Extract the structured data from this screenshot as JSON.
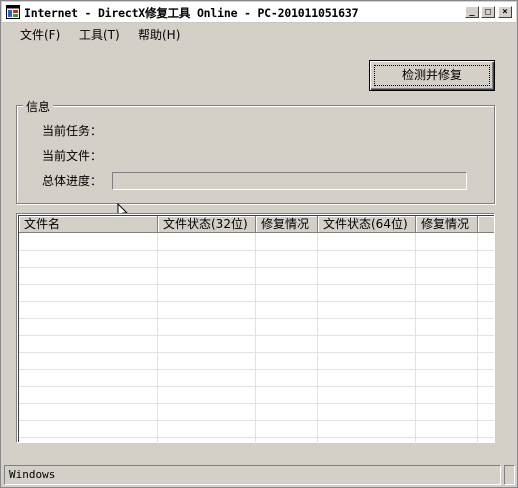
{
  "window": {
    "title": "Internet - DirectX修复工具 Online - PC-201011051637",
    "controls": {
      "minimize": "_",
      "maximize": "□",
      "close": "×"
    }
  },
  "menu": [
    {
      "label": "文件(F)"
    },
    {
      "label": "工具(T)"
    },
    {
      "label": "帮助(H)"
    }
  ],
  "action_button": "检测并修复",
  "info_group": {
    "title": "信息",
    "current_task_label": "当前任务：",
    "current_file_label": "当前文件：",
    "overall_progress_label": "总体进度：",
    "progress": 0
  },
  "table": {
    "columns": [
      "文件名",
      "文件状态(32位)",
      "修复情况",
      "文件状态(64位)",
      "修复情况"
    ],
    "rows": []
  },
  "status_bar": {
    "text": "Windows"
  },
  "colors": {
    "face": "#d4d0c8",
    "shadow": "#808080",
    "highlight": "#ffffff",
    "window": "#ffffff"
  },
  "icons": [
    "app-icon",
    "mouse-cursor-icon",
    "size-grip-icon"
  ]
}
